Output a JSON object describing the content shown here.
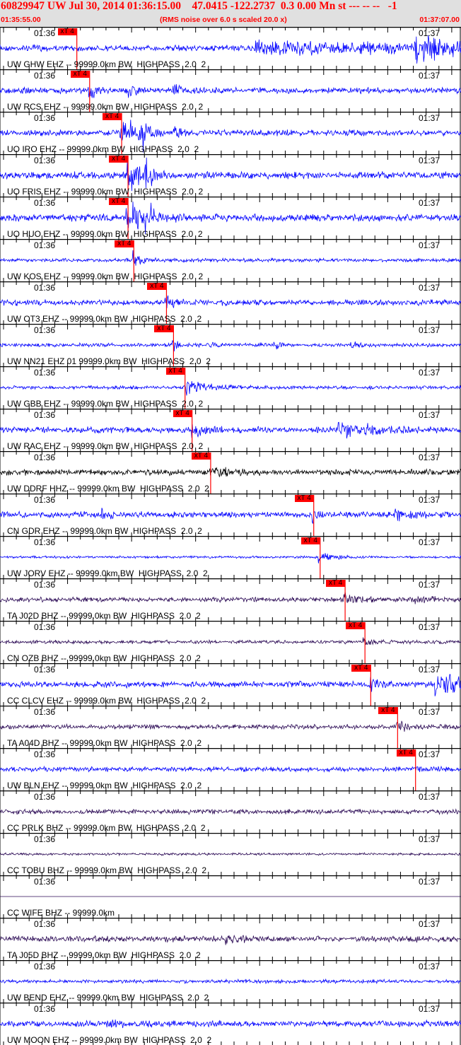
{
  "header": {
    "title": "60829947 UW Jul 30, 2014 01:36:15.00    47.0415 -122.2737  0.3 0.00 Mn st --- -- --   -1",
    "start_time": "01:35:55.00",
    "note": "(RMS noise over 6.0 s scaled 20.0 x)",
    "end_time": "01:37:07.00"
  },
  "chart_data": {
    "type": "line",
    "title": "Seismogram record section",
    "x_range_seconds": [
      0,
      72
    ],
    "tick_left": "01:36",
    "tick_right": "01:37",
    "pick_label": "xT 4",
    "colors": {
      "blue": "#0000ff",
      "black": "#000000",
      "purple": "#2b0a55",
      "pick": "#ff0000"
    },
    "traces": [
      {
        "label": "UW GHW EHZ -- 99999.0km BW  HIGHPASS  2.0  2",
        "color": "#0000ff",
        "pick_s": 12.0
      },
      {
        "label": "UW RCS EHZ -- 99999.0km BW  HIGHPASS  2.0  2",
        "color": "#0000ff",
        "pick_s": 14.0
      },
      {
        "label": "UO IRO EHZ -- 99999.0km BW  HIGHPASS  2.0  2",
        "color": "#0000ff",
        "pick_s": 19.0
      },
      {
        "label": "UO FRIS EHZ -- 99999.0km BW  HIGHPASS  2.0  2",
        "color": "#0000ff",
        "pick_s": 20.0
      },
      {
        "label": "UO HUO EHZ -- 99999.0km BW  HIGHPASS  2.0  2",
        "color": "#0000ff",
        "pick_s": 20.0
      },
      {
        "label": "UW KOS EHZ -- 99999.0km BW  HIGHPASS  2.0  2",
        "color": "#0000ff",
        "pick_s": 20.9
      },
      {
        "label": "UW OT3 EHZ -- 99999.0km BW  HIGHPASS  2.0  2",
        "color": "#0000ff",
        "pick_s": 26.0
      },
      {
        "label": "UW NN21 EHZ 01 99999.0km BW  HIGHPASS  2.0  2",
        "color": "#0000ff",
        "pick_s": 27.1
      },
      {
        "label": "UW GBB EHZ -- 99999.0km BW  HIGHPASS  2.0  2",
        "color": "#0000ff",
        "pick_s": 28.9
      },
      {
        "label": "UW RAC EHZ -- 99999.0km BW  HIGHPASS  2.0  2",
        "color": "#0000ff",
        "pick_s": 30.0
      },
      {
        "label": "UW DDRF HHZ -- 99999.0km BW  HIGHPASS  2.0  2",
        "color": "#000000",
        "pick_s": 32.9
      },
      {
        "label": "CN GDR EHZ -- 99999.0km BW  HIGHPASS  2.0  2",
        "color": "#0000ff",
        "pick_s": 49.0
      },
      {
        "label": "UW JORV EHZ -- 99999.0km BW  HIGHPASS  2.0  2",
        "color": "#0000ff",
        "pick_s": 50.0
      },
      {
        "label": "TA J02D BHZ -- 99999.0km BW  HIGHPASS  2.0  2",
        "color": "#2b0a55",
        "pick_s": 53.9
      },
      {
        "label": "CN OZB BHZ -- 99999.0km BW  HIGHPASS  2.0  2",
        "color": "#2b0a55",
        "pick_s": 57.0
      },
      {
        "label": "CC CLCV EHZ -- 99999.0km BW  HIGHPASS  2.0  2",
        "color": "#0000ff",
        "pick_s": 57.9
      },
      {
        "label": "TA A04D BHZ -- 99999.0km BW  HIGHPASS  2.0  2",
        "color": "#2b0a55",
        "pick_s": 62.1
      },
      {
        "label": "UW BLN EHZ -- 99999.0km BW  HIGHPASS  2.0  2",
        "color": "#0000ff",
        "pick_s": 64.9
      },
      {
        "label": "CC PRLK BHZ -- 99999.0km BW  HIGHPASS  2.0  2",
        "color": "#2b0a55",
        "pick_s": null
      },
      {
        "label": "CC TOBU BHZ -- 99999.0km BW  HIGHPASS  2.0  2",
        "color": "#2b0a55",
        "pick_s": null
      },
      {
        "label": "CC WIFE BHZ -- 99999.0km",
        "color": "#2b0a55",
        "pick_s": null
      },
      {
        "label": "TA J05D BHZ -- 99999.0km BW  HIGHPASS  2.0  2",
        "color": "#2b0a55",
        "pick_s": null
      },
      {
        "label": "UW BEND EHZ -- 99999.0km BW  HIGHPASS  2.0  2",
        "color": "#0000ff",
        "pick_s": null
      },
      {
        "label": "UW MOON EHZ -- 99999.0km BW  HIGHPASS  2.0  2",
        "color": "#0000ff",
        "pick_s": null
      }
    ]
  }
}
